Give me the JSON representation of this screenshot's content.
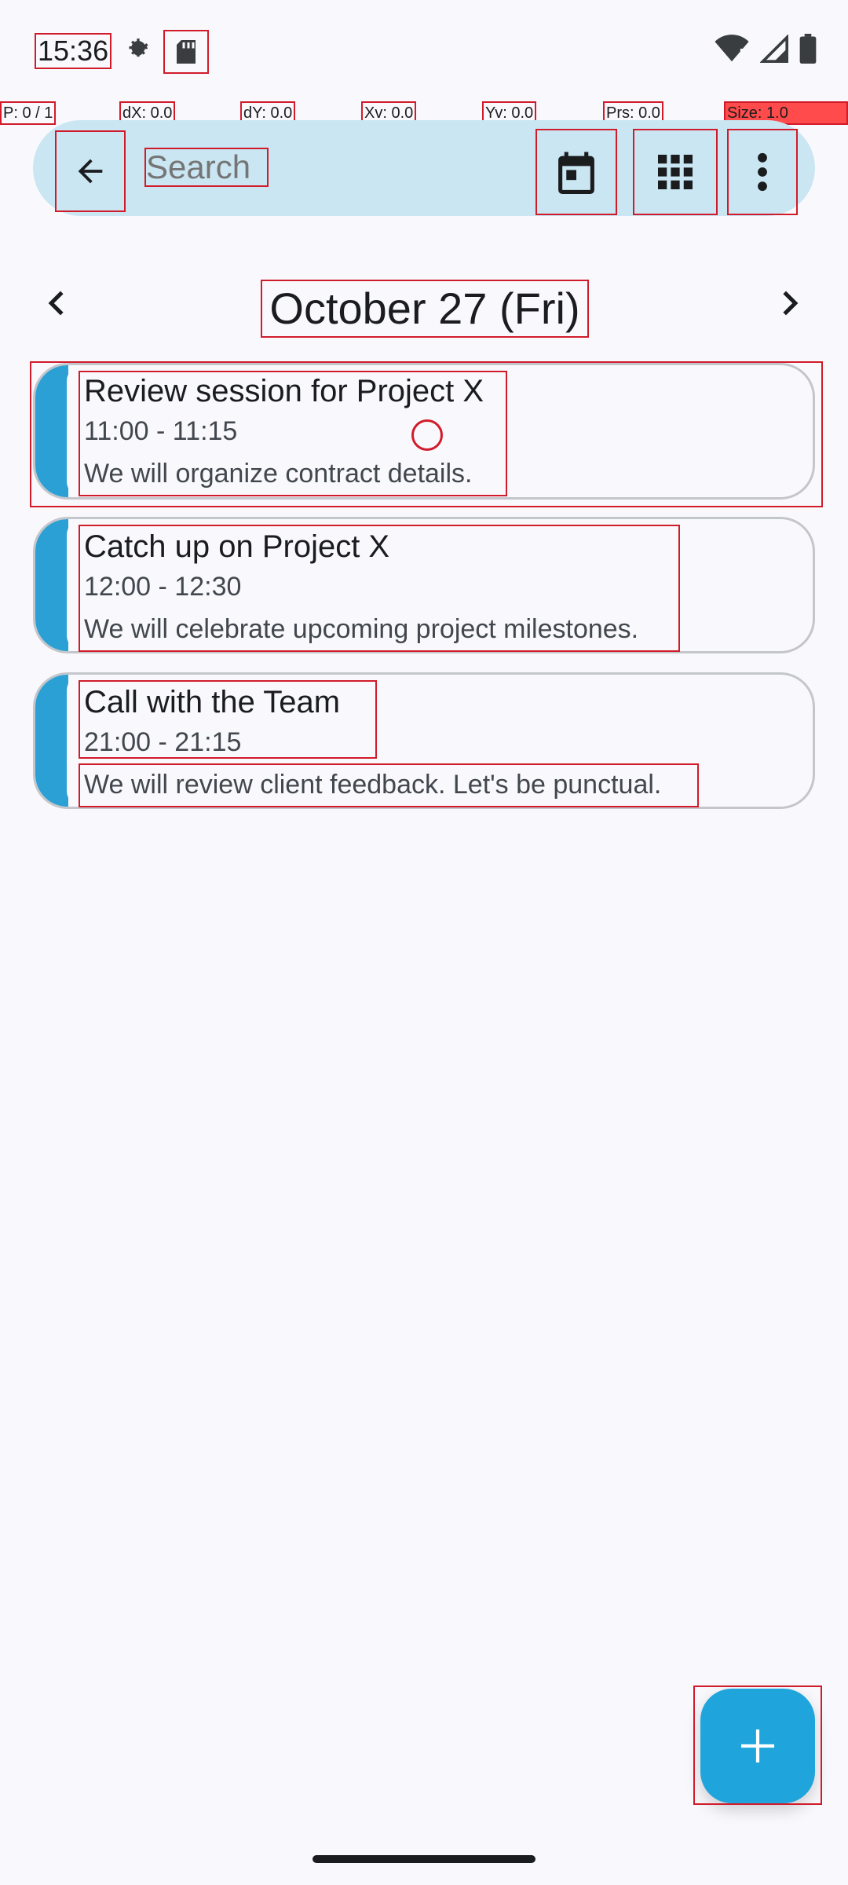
{
  "status_bar": {
    "time": "15:36",
    "icons": [
      "gear-icon",
      "sd-card-icon",
      "wifi-icon",
      "signal-icon",
      "battery-icon"
    ]
  },
  "pointer_info": {
    "p": "P: 0 / 1",
    "dx": "dX: 0.0",
    "dy": "dY: 0.0",
    "xv": "Xv: 0.0",
    "yv": "Yv: 0.0",
    "prs": "Prs: 0.0",
    "size": "Size: 1.0"
  },
  "toolbar": {
    "search_placeholder": "Search",
    "icons": [
      "back-arrow-icon",
      "calendar-today-icon",
      "grid-view-icon",
      "more-vert-icon"
    ]
  },
  "date_header": {
    "title": "October 27 (Fri)"
  },
  "events": [
    {
      "title": "Review session for Project X",
      "time": "11:00 - 11:15",
      "description": "We will organize contract details."
    },
    {
      "title": "Catch up on Project X",
      "time": "12:00 - 12:30",
      "description": "We will celebrate upcoming project milestones."
    },
    {
      "title": "Call with the Team",
      "time": "21:00 - 21:15",
      "description": "We will review client feedback. Let's be punctual."
    }
  ],
  "colors": {
    "accent": "#1fa5dc",
    "search_bar_bg": "#c9e6f2",
    "event_stripe": "#2aa0d4"
  }
}
